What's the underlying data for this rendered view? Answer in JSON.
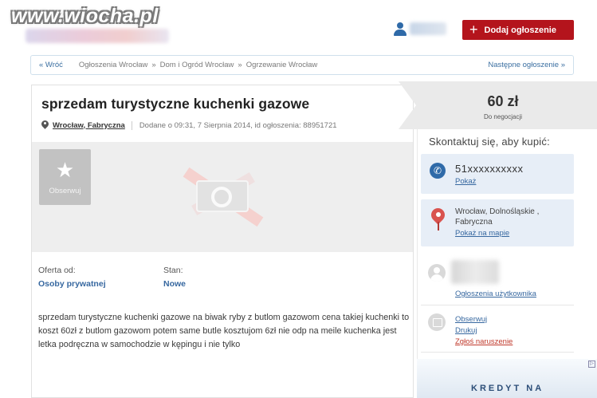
{
  "watermark": "www.wiocha.pl",
  "header": {
    "add_button": "Dodaj ogłoszenie"
  },
  "breadcrumb": {
    "back": "« Wróć",
    "items": [
      "Ogłoszenia Wrocław",
      "Dom i Ogród Wrocław",
      "Ogrzewanie Wrocław"
    ],
    "separator": "»",
    "next": "Następne ogłoszenie »"
  },
  "listing": {
    "title": "sprzedam turystyczne kuchenki gazowe",
    "location": "Wrocław, Fabryczna",
    "added": "Dodane o 09:31, 7 Sierpnia 2014, id ogłoszenia: 88951721",
    "observe_label": "Obserwuj",
    "offer_from_key": "Oferta od:",
    "offer_from_value": "Osoby prywatnej",
    "condition_key": "Stan:",
    "condition_value": "Nowe",
    "description": "sprzedam turystyczne kuchenki gazowe na biwak ryby z butlom gazowom cena takiej kuchenki to koszt 60zł z butlom gazowom potem same butle kosztujom 6zł nie odp na meile kuchenka jest letka podręczna w samochodzie w kępingu i nie tylko"
  },
  "sidebar": {
    "price": "60 zł",
    "price_note": "Do negocjacji",
    "contact_heading": "Skontaktuj się, aby kupić:",
    "phone": "51xxxxxxxxxx",
    "phone_link": "Pokaż",
    "address_line1": "Wrocław, Dolnośląskie ,",
    "address_line2": "Fabryczna",
    "map_link": "Pokaż na mapie",
    "user_listings_link": "Ogłoszenia użytkownika",
    "observe": "Obserwuj",
    "print": "Drukuj",
    "report": "Zgłoś naruszenie",
    "ad_text": "KREDYT NA"
  },
  "colors": {
    "accent_red": "#b4141c",
    "link_blue": "#3768a0",
    "icon_blue": "#2f6aa8",
    "pin_red": "#d9534f"
  }
}
